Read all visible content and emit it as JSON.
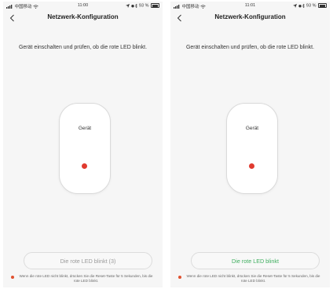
{
  "screens": [
    {
      "status": {
        "carrier": "中国移动",
        "time": "11:00",
        "battery": "93 %"
      },
      "nav": {
        "title": "Netzwerk-Konfiguration"
      },
      "instruction": "Gerät einschalten und prüfen, ob die rote LED blinkt.",
      "device": {
        "label": "Gerät",
        "led_color": "#e03a2f"
      },
      "button": {
        "label": "Die rote LED blinkt (3)",
        "state": "disabled"
      },
      "hint": "Wenn die rote LED nicht blinkt, drücken Sie die Reset-Taste für 5 Sekunden, bis die rote LED blinkt."
    },
    {
      "status": {
        "carrier": "中国移动",
        "time": "11:01",
        "battery": "93 %"
      },
      "nav": {
        "title": "Netzwerk-Konfiguration"
      },
      "instruction": "Gerät einschalten und prüfen, ob die rote LED blinkt.",
      "device": {
        "label": "Gerät",
        "led_color": "#e03a2f"
      },
      "button": {
        "label": "Die rote LED blinkt",
        "state": "enabled"
      },
      "hint": "Wenn die rote LED nicht blinkt, drücken Sie die Reset-Taste für 5 Sekunden, bis die rote LED blinkt."
    }
  ],
  "colors": {
    "accent_green": "#3fae5f",
    "led_red": "#e03a2f",
    "disabled_text": "#9a9a9a"
  },
  "icons": [
    "signal-icon",
    "wifi-icon",
    "location-icon",
    "bluetooth-icon",
    "battery-icon",
    "back-chevron-icon",
    "warning-dot-icon"
  ]
}
